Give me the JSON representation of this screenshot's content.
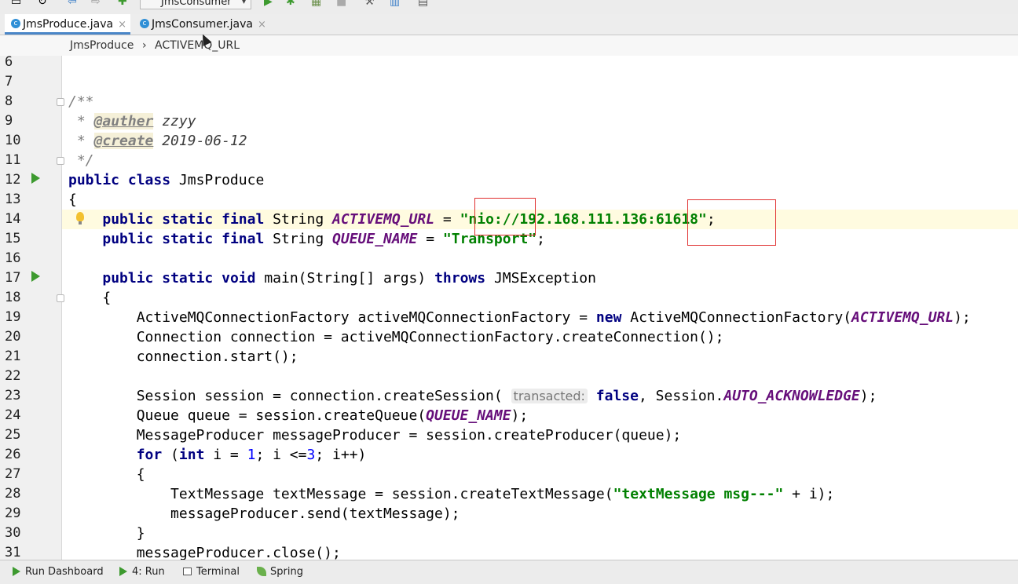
{
  "toolbar": {
    "run_config_label": "JmsConsumer",
    "icons": [
      "save-icon",
      "sync-icon",
      "back-arrow-icon",
      "forward-arrow-icon",
      "build-icon",
      "run-icon",
      "debug-icon",
      "coverage-icon",
      "stop-icon",
      "project-structure-icon",
      "sdk-icon",
      "layout-icon"
    ]
  },
  "tabs": [
    {
      "label": "JmsProduce.java",
      "active": true,
      "close": "×"
    },
    {
      "label": "JmsConsumer.java",
      "active": false,
      "close": "×"
    }
  ],
  "breadcrumb": {
    "class_name": "JmsProduce",
    "separator": "›",
    "field_name": "ACTIVEMQ_URL"
  },
  "editor": {
    "line_numbers": [
      "6",
      "7",
      "8",
      "9",
      "10",
      "11",
      "12",
      "13",
      "14",
      "15",
      "16",
      "17",
      "18",
      "19",
      "20",
      "21",
      "22",
      "23",
      "24",
      "25",
      "26",
      "27",
      "28",
      "29",
      "30",
      "31"
    ],
    "code": {
      "l8": "/**",
      "l9_star": " * ",
      "l9_tag": "@auther",
      "l9_val": "zzyy",
      "l10_star": " * ",
      "l10_tag": "@create",
      "l10_val": "2019-06-12",
      "l11": " */",
      "kw_public": "public",
      "kw_class": "class",
      "kw_static": "static",
      "kw_final": "final",
      "kw_void": "void",
      "kw_throws": "throws",
      "kw_new": "new",
      "kw_for": "for",
      "kw_int": "int",
      "kw_false": "false",
      "class_name": "JmsProduce",
      "brace_open": "{",
      "brace_close": "}",
      "type_string": "String",
      "field_url": "ACTIVEMQ_URL",
      "field_queue": "QUEUE_NAME",
      "field_ack": "AUTO_ACKNOWLEDGE",
      "eq": " = ",
      "url_value": "\"nio://192.168.111.136:61618\"",
      "queue_value": "\"Transport\"",
      "semi": ";",
      "main_sig": "main(String[] args)",
      "jms_exception": "JMSException",
      "l19_a": "ActiveMQConnectionFactory activeMQConnectionFactory = ",
      "l19_b": "ActiveMQConnectionFactory(",
      "l19_c": ");",
      "l20": "Connection connection = activeMQConnectionFactory.createConnection();",
      "l21": "connection.start();",
      "l23_a": "Session session = connection.createSession(",
      "l23_hint": "transacted:",
      "l23_b": ", Session.",
      "l23_c": ");",
      "l24_a": "Queue queue = session.createQueue(",
      "l24_b": ");",
      "l25": "MessageProducer messageProducer = session.createProducer(queue);",
      "l26_a": " (",
      "l26_b": " i = ",
      "l26_one": "1",
      "l26_c": "; i <=",
      "l26_three": "3",
      "l26_d": "; i++)",
      "l28_a": "TextMessage textMessage = session.createTextMessage(",
      "l28_str": "\"textMessage msg---\"",
      "l28_b": " + i);",
      "l29": "messageProducer.send(textMessage);",
      "l31": "messageProducer.close();"
    }
  },
  "bottom_bar": [
    {
      "label": "Run Dashboard",
      "icon": "run-dashboard-icon"
    },
    {
      "label": "4: Run",
      "icon": "run-icon"
    },
    {
      "label": "Terminal",
      "icon": "terminal-icon"
    },
    {
      "label": "Spring",
      "icon": "spring-leaf-icon"
    }
  ],
  "colors": {
    "keyword": "#000080",
    "string": "#008000",
    "field": "#660e7a",
    "comment": "#808080",
    "number": "#0000ff",
    "highlight_box": "#e03030",
    "run_gutter": "#3d9a2f"
  }
}
